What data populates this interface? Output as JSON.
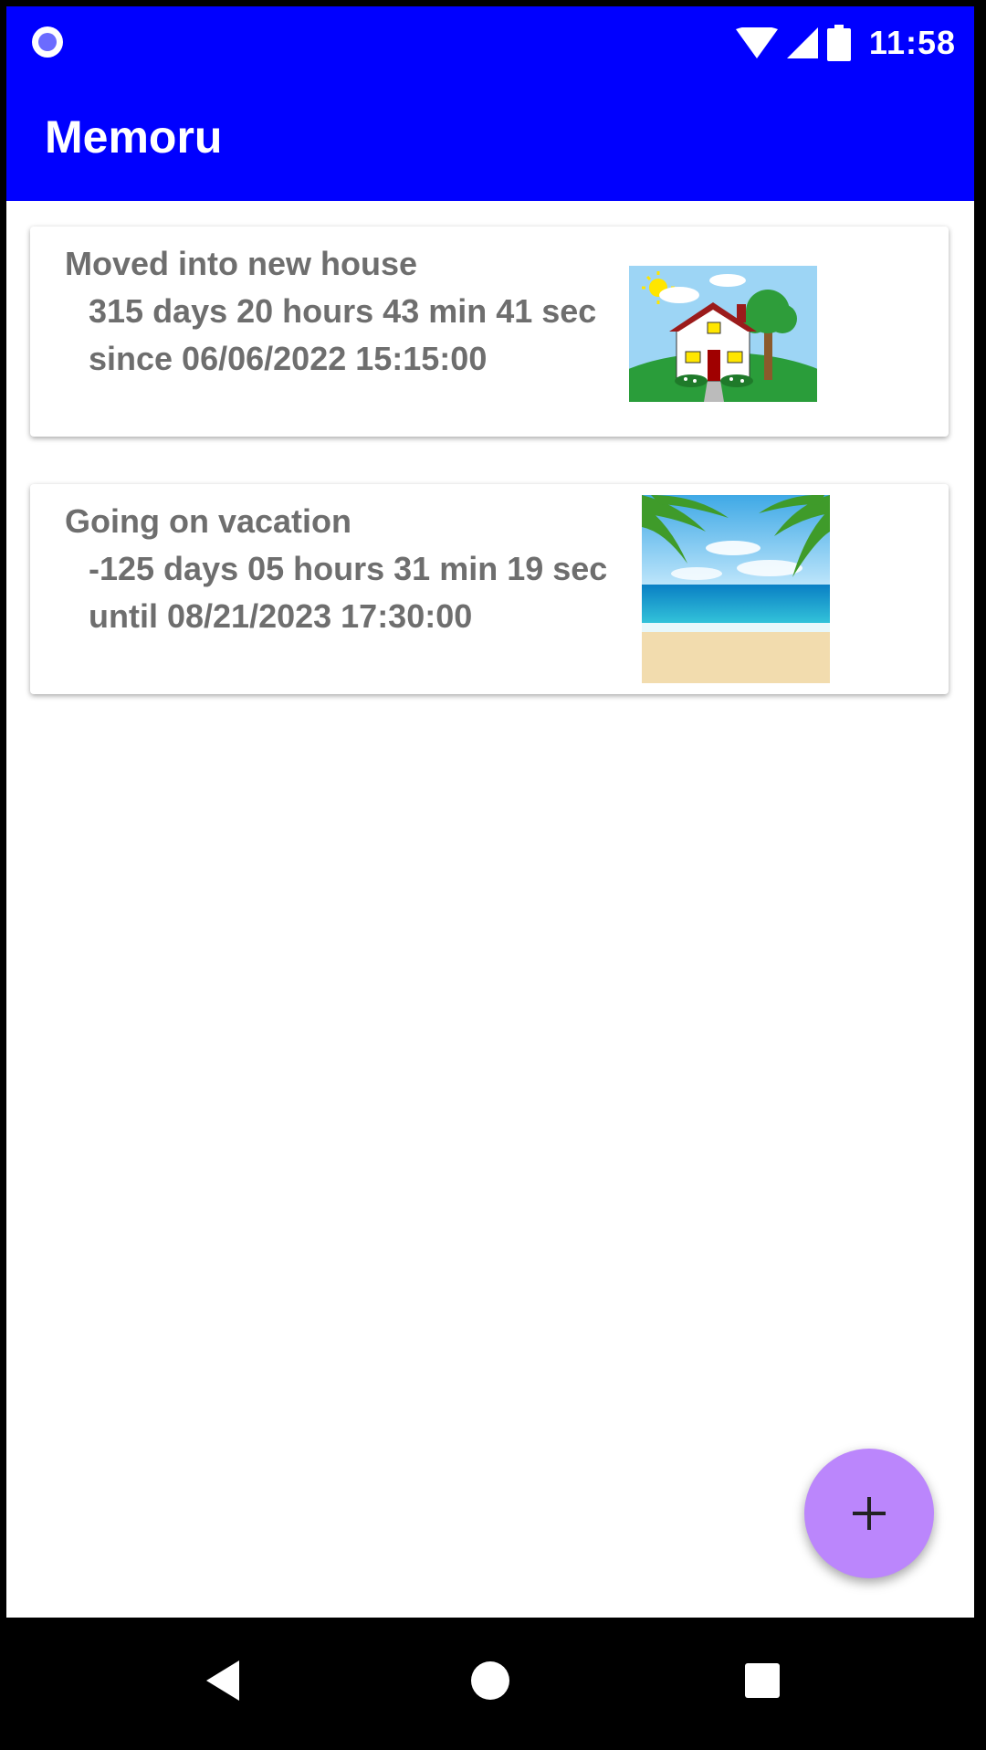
{
  "status_bar": {
    "time": "11:58",
    "icons": [
      "record-icon",
      "wifi-icon",
      "signal-icon",
      "battery-icon"
    ]
  },
  "app_bar": {
    "title": "Memoru"
  },
  "memories": [
    {
      "title": "Moved into new house",
      "elapsed": "315 days 20 hours 43 min 41 sec",
      "date_line": "since 06/06/2022 15:15:00",
      "image": "house-illustration"
    },
    {
      "title": "Going on vacation",
      "elapsed": "-125 days 05 hours 31 min 19 sec",
      "date_line": "until 08/21/2023 17:30:00",
      "image": "beach-illustration"
    }
  ],
  "fab": {
    "label": "+",
    "icon": "plus-icon"
  },
  "nav_bar": {
    "icons": [
      "back-icon",
      "home-icon",
      "recents-icon"
    ]
  },
  "colors": {
    "primary": "#0000ff",
    "accent": "#bb86fc",
    "card_text": "#6e6e6e"
  }
}
